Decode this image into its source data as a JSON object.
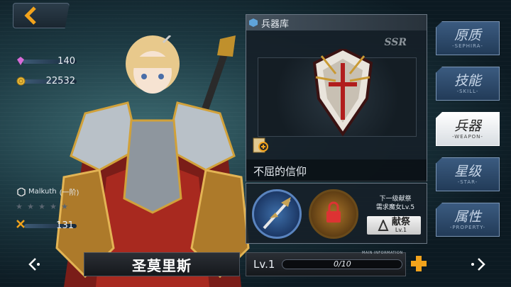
{
  "resources": {
    "crystals": "140",
    "coins": "22532"
  },
  "character": {
    "sephira": "Malkuth",
    "sephira_rank": "(一阶)",
    "hp_value": "131",
    "stars_total": 5,
    "name": "圣莫里斯"
  },
  "weapon_panel": {
    "title": "兵器库",
    "rarity": "SSR",
    "weapon_name": "不屈的信仰",
    "next_offering_line1": "下一级献祭",
    "next_offering_line2": "需求魔女Lv.5",
    "offer_button_label": "献祭",
    "offer_button_level": "Lv.1"
  },
  "level_bar": {
    "level": "Lv.1",
    "exp_text": "0/10",
    "exp_fraction": 0,
    "caption": "MAIN INFORMATION"
  },
  "tabs": [
    {
      "cn": "原质",
      "en": "-SEPHIRA-"
    },
    {
      "cn": "技能",
      "en": "-SKILL-"
    },
    {
      "cn": "兵器",
      "en": "-WEAPON-"
    },
    {
      "cn": "星级",
      "en": "-STAR-"
    },
    {
      "cn": "属性",
      "en": "-PROPERTY-"
    }
  ],
  "active_tab": "兵器",
  "colors": {
    "accent_orange": "#f2a31c",
    "panel_border": "#6b7784",
    "tab_blue": "#3b5b80"
  },
  "icons": [
    "back-arrow-icon",
    "crystal-icon",
    "coin-icon",
    "hexagon-icon",
    "star-icon",
    "sword-cross-icon",
    "chevron-left-icon",
    "chevron-right-icon",
    "plus-icon",
    "magnify-scroll-icon",
    "wing-icon",
    "lock-icon"
  ]
}
